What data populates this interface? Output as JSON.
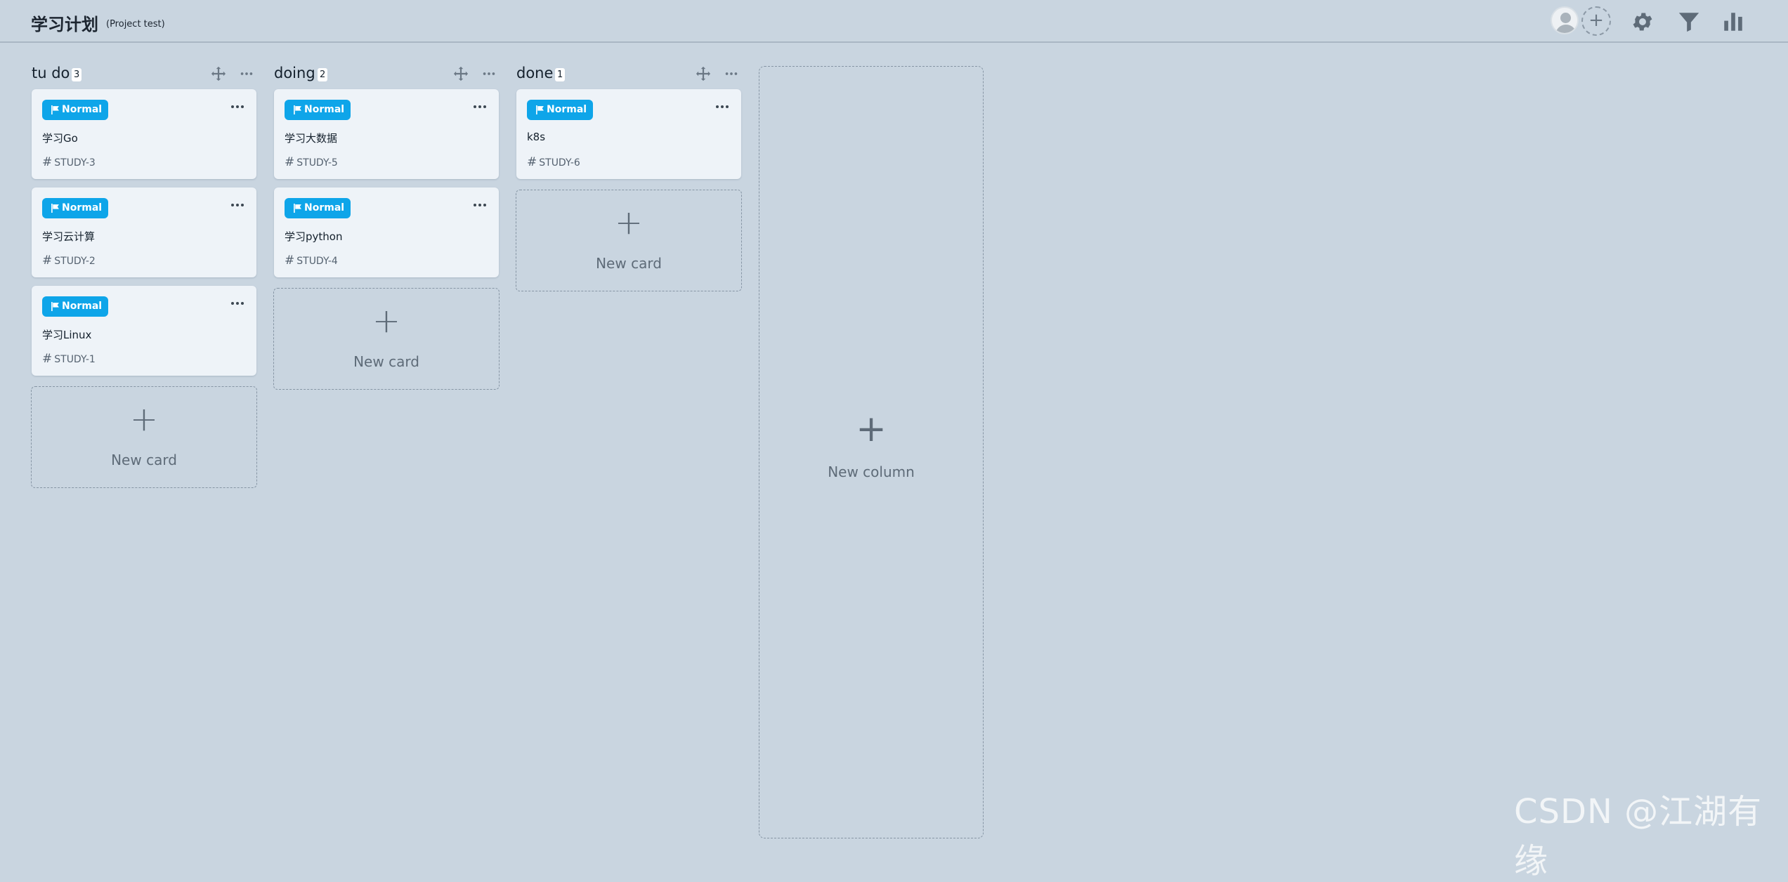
{
  "header": {
    "title": "学习计划",
    "subtitle": "(Project test)"
  },
  "toolbar": {
    "add_member_label": "+",
    "icons": [
      "user-avatar",
      "add-member-icon",
      "gear-icon",
      "filter-icon",
      "bar-chart-icon"
    ]
  },
  "columns": [
    {
      "title": "tu do",
      "count": "3",
      "cards": [
        {
          "priority": "Normal",
          "title": "学习Go",
          "id": "STUDY-3"
        },
        {
          "priority": "Normal",
          "title": "学习云计算",
          "id": "STUDY-2"
        },
        {
          "priority": "Normal",
          "title": "学习Linux",
          "id": "STUDY-1"
        }
      ],
      "new_card_label": "New card"
    },
    {
      "title": "doing",
      "count": "2",
      "cards": [
        {
          "priority": "Normal",
          "title": "学习大数据",
          "id": "STUDY-5"
        },
        {
          "priority": "Normal",
          "title": "学习python",
          "id": "STUDY-4"
        }
      ],
      "new_card_label": "New card"
    },
    {
      "title": "done",
      "count": "1",
      "cards": [
        {
          "priority": "Normal",
          "title": "k8s",
          "id": "STUDY-6"
        }
      ],
      "new_card_label": "New card"
    }
  ],
  "new_column": {
    "plus": "+",
    "label": "New column"
  },
  "plus_glyph": "+",
  "hash_glyph": "#",
  "colors": {
    "background": "#c9d5e0",
    "card": "#eef3f8",
    "badge": "#0ea5e9",
    "icon": "#5e6b78"
  },
  "watermark": "CSDN @江湖有缘"
}
